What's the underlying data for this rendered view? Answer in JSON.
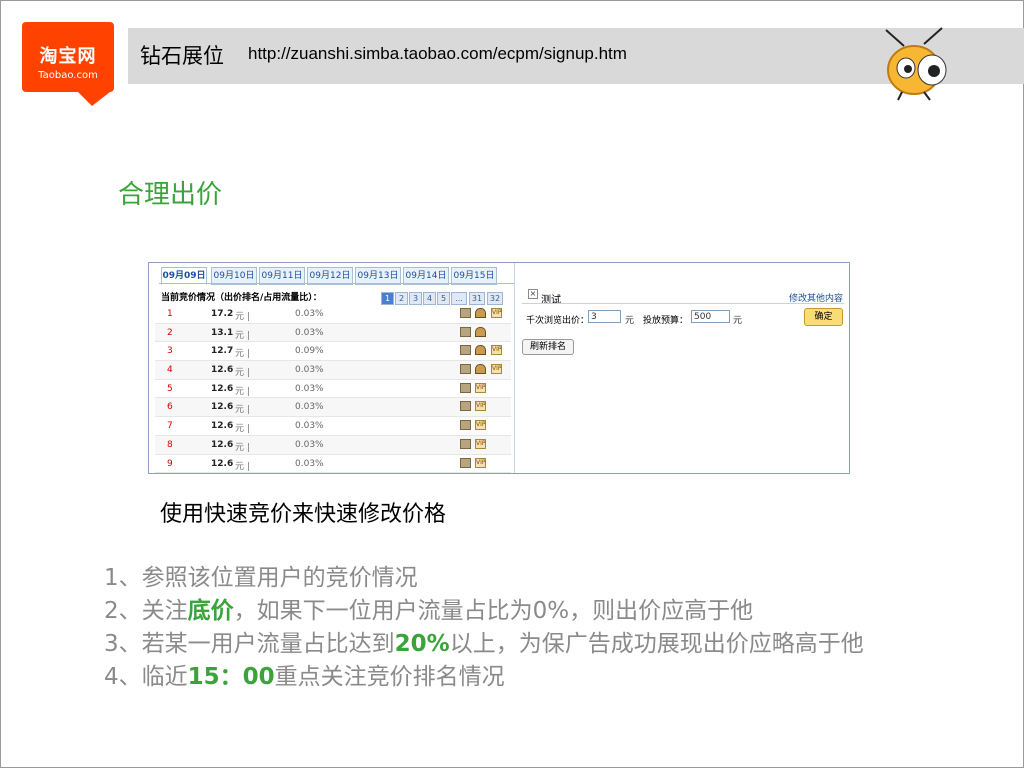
{
  "header": {
    "logo_cn": "淘宝网",
    "logo_en": "Taobao.com",
    "title": "钻石展位",
    "url": "http://zuanshi.simba.taobao.com/ecpm/signup.htm",
    "brand_color": "#ff4200"
  },
  "section_title": "合理出价",
  "screenshot": {
    "tabs": [
      "09月09日",
      "09月10日",
      "09月11日",
      "09月12日",
      "09月13日",
      "09月14日",
      "09月15日"
    ],
    "active_tab": "09月09日",
    "left_title": "当前竞价情况（出价排名/占用流量比）：",
    "pager": [
      "1",
      "2",
      "3",
      "4",
      "5",
      "...",
      "31",
      "32"
    ],
    "rows": [
      {
        "rank": "1",
        "price": "17.2",
        "unit": "元 |",
        "pct": "0.03%",
        "icons": [
          "building-icon",
          "people-icon",
          "vip-icon"
        ]
      },
      {
        "rank": "2",
        "price": "13.1",
        "unit": "元 |",
        "pct": "0.03%",
        "icons": [
          "building-icon",
          "people-icon"
        ]
      },
      {
        "rank": "3",
        "price": "12.7",
        "unit": "元 |",
        "pct": "0.09%",
        "icons": [
          "building-icon",
          "people-icon",
          "vip-icon"
        ]
      },
      {
        "rank": "4",
        "price": "12.6",
        "unit": "元 |",
        "pct": "0.03%",
        "icons": [
          "building-icon",
          "people-icon",
          "vip-icon"
        ]
      },
      {
        "rank": "5",
        "price": "12.6",
        "unit": "元 |",
        "pct": "0.03%",
        "icons": [
          "building-icon",
          "vip-icon"
        ]
      },
      {
        "rank": "6",
        "price": "12.6",
        "unit": "元 |",
        "pct": "0.03%",
        "icons": [
          "building-icon",
          "vip-icon"
        ]
      },
      {
        "rank": "7",
        "price": "12.6",
        "unit": "元 |",
        "pct": "0.03%",
        "icons": [
          "building-icon",
          "vip-icon"
        ]
      },
      {
        "rank": "8",
        "price": "12.6",
        "unit": "元 |",
        "pct": "0.03%",
        "icons": [
          "building-icon",
          "vip-icon"
        ]
      },
      {
        "rank": "9",
        "price": "12.6",
        "unit": "元 |",
        "pct": "0.03%",
        "icons": [
          "building-icon",
          "vip-icon"
        ]
      }
    ],
    "right": {
      "close_glyph": "×",
      "name": "测试",
      "edit_link": "修改其他内容",
      "bid_label": "千次浏览出价：",
      "bid_value": "3",
      "bid_unit": "元",
      "budget_label": "投放预算：",
      "budget_value": "500",
      "budget_unit": "元",
      "confirm_label": "确定",
      "refresh_label": "刷新排名"
    }
  },
  "caption": "使用快速竞价来快速修改价格",
  "tips": [
    {
      "parts": [
        {
          "text": "1、参照该位置用户的竞价情况",
          "hl": false
        }
      ]
    },
    {
      "parts": [
        {
          "text": "2、关注",
          "hl": false
        },
        {
          "text": "底价",
          "hl": true
        },
        {
          "text": "，如果下一位用户流量占比为0%，则出价应高于他",
          "hl": false
        }
      ]
    },
    {
      "parts": [
        {
          "text": "3、若某一用户流量占比达到",
          "hl": false
        },
        {
          "text": "20%",
          "hl": true
        },
        {
          "text": "以上，为保广告成功展现出价应略高于他",
          "hl": false
        }
      ]
    },
    {
      "parts": [
        {
          "text": "4、临近",
          "hl": false
        },
        {
          "text": "15：00",
          "hl": true
        },
        {
          "text": "重点关注竞价排名情况",
          "hl": false
        }
      ]
    }
  ],
  "colors": {
    "highlight": "#3aa33a",
    "rank": "#d40000",
    "link": "#1a4f99"
  }
}
